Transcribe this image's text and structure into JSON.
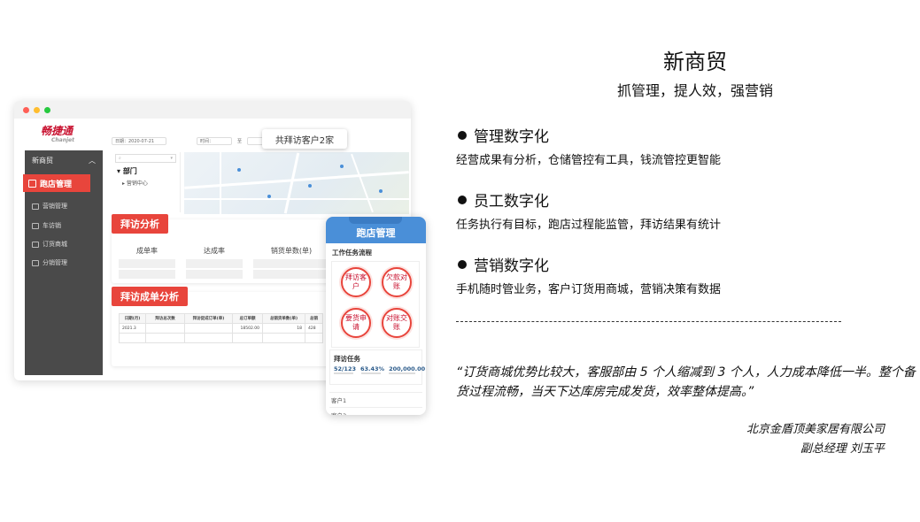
{
  "mockup": {
    "brand": {
      "name": "畅捷通",
      "sub": "Chanjet"
    },
    "nav": {
      "header": "新商贸",
      "active": "跑店管理",
      "items": [
        "营销管理",
        "车访销",
        "订货商城",
        "分销管理"
      ]
    },
    "filters": [
      "日期：2020-07-21",
      "时间：",
      "至"
    ],
    "tree": {
      "root": "部门",
      "child": "营销中心"
    },
    "visit_badge": "共拜访客户2家",
    "visit_analysis": {
      "title": "拜访分析",
      "stats": [
        "成单率",
        "达成率",
        "销货单数(单)"
      ]
    },
    "order_analysis": {
      "title": "拜访成单分析",
      "columns": [
        "日期(月)",
        "拜访总次数",
        "拜访促成订单(单)",
        "总订单额",
        "总销货单数(单)",
        "总销"
      ],
      "rows": [
        [
          "2021.3",
          "",
          "",
          "18502.00",
          "18",
          "428"
        ]
      ]
    },
    "phone": {
      "header": "跑店管理",
      "flow_title": "工作任务流程",
      "flow_steps": [
        "拜访客户",
        "欠款对账",
        "要货申请",
        "对账交账"
      ],
      "task_title": "拜访任务",
      "task_values": [
        "52/123",
        "63.43%",
        "200,000.00"
      ],
      "customers": [
        "客户1",
        "客户3"
      ]
    }
  },
  "content": {
    "title": "新商贸",
    "subtitle": "抓管理，提人效，强营销",
    "features": [
      {
        "heading": "管理数字化",
        "description": "经营成果有分析，仓储管控有工具，钱流管控更智能"
      },
      {
        "heading": "员工数字化",
        "description": "任务执行有目标，跑店过程能监管，拜访结果有统计"
      },
      {
        "heading": "营销数字化",
        "description": "手机随时管业务，客户订货用商城，营销决策有数据"
      }
    ],
    "quote": "“订货商城优势比较大，客服部由 5 个人缩减到 3 个人，人力成本降低一半。整个备货过程流畅，当天下达库房完成发货，效率整体提高。”",
    "company": "北京金盾顶美家居有限公司",
    "person": "副总经理 刘玉平"
  },
  "colors": {
    "accent": "#e8453c",
    "phone_header": "#4a8fd8",
    "text": "#111111"
  }
}
